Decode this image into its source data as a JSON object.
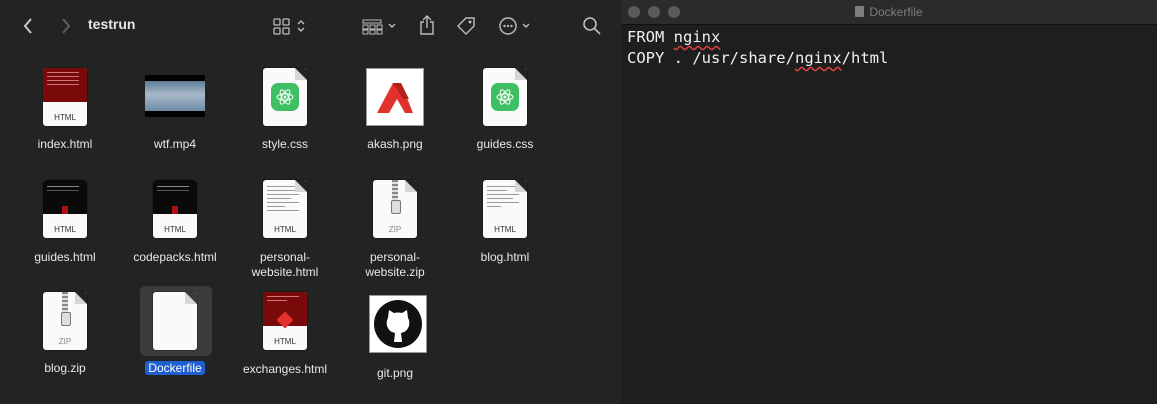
{
  "finder": {
    "title": "testrun",
    "toolbar_icons": [
      "chevron-left-icon",
      "chevron-right-icon",
      "grid-view-icon",
      "group-icon",
      "share-icon",
      "tag-icon",
      "more-icon",
      "search-icon"
    ],
    "files": [
      {
        "name": "index.html",
        "kind": "html",
        "tag": "HTML"
      },
      {
        "name": "wtf.mp4",
        "kind": "video"
      },
      {
        "name": "style.css",
        "kind": "atom-css"
      },
      {
        "name": "akash.png",
        "kind": "image-akash"
      },
      {
        "name": "guides.css",
        "kind": "atom-css"
      },
      {
        "name": "guides.html",
        "kind": "html",
        "tag": "HTML"
      },
      {
        "name": "codepacks.html",
        "kind": "html",
        "tag": "HTML"
      },
      {
        "name": "personal-\nwebsite.html",
        "kind": "html",
        "tag": "HTML"
      },
      {
        "name": "personal-\nwebsite.zip",
        "kind": "zip",
        "tag": "ZIP"
      },
      {
        "name": "blog.html",
        "kind": "html",
        "tag": "HTML"
      },
      {
        "name": "blog.zip",
        "kind": "zip",
        "tag": "ZIP"
      },
      {
        "name": "Dockerfile",
        "kind": "blank",
        "selected": true
      },
      {
        "name": "exchanges.html",
        "kind": "html",
        "tag": "HTML"
      },
      {
        "name": "git.png",
        "kind": "image-github"
      }
    ]
  },
  "editor": {
    "title": "Dockerfile",
    "lines": [
      "FROM nginx",
      "COPY . /usr/share/nginx/html"
    ]
  },
  "colors": {
    "selection": "#1f5fd0",
    "finder_bg": "#232323",
    "editor_bg": "#1e1e1e",
    "atom_green": "#3fbf63",
    "akash_red": "#e0322b"
  }
}
